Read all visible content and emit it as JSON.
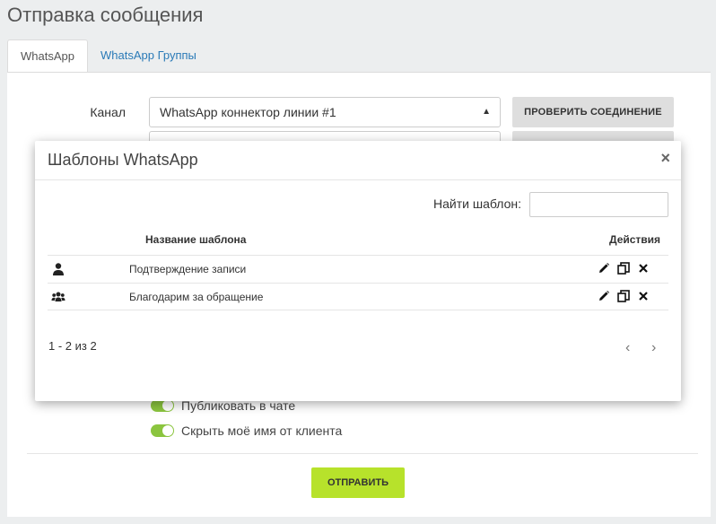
{
  "page": {
    "title": "Отправка сообщения",
    "tabs": [
      "WhatsApp",
      "WhatsApp Группы"
    ]
  },
  "form": {
    "channel_label": "Канал",
    "channel_value": "WhatsApp коннектор линии #1",
    "check_connection": "ПРОВЕРИТЬ СОЕДИНЕНИЕ",
    "publish_in_chat": "Публиковать в чате",
    "hide_my_name": "Скрыть моё имя от клиента",
    "send": "ОТПРАВИТЬ"
  },
  "modal": {
    "title": "Шаблоны WhatsApp",
    "close_glyph": "×",
    "search_label": "Найти шаблон:",
    "search_value": "",
    "columns": {
      "name": "Название шаблона",
      "actions": "Действия"
    },
    "rows": [
      {
        "icon": "user-icon",
        "name": "Подтверждение записи"
      },
      {
        "icon": "users-icon",
        "name": "Благодарим за обращение"
      }
    ],
    "pager_text": "1 - 2 из 2",
    "prev_glyph": "‹",
    "next_glyph": "›"
  },
  "colors": {
    "accent_green": "#b7e22b",
    "toggle_green": "#8bc53f",
    "link_blue": "#2a7ab7"
  }
}
